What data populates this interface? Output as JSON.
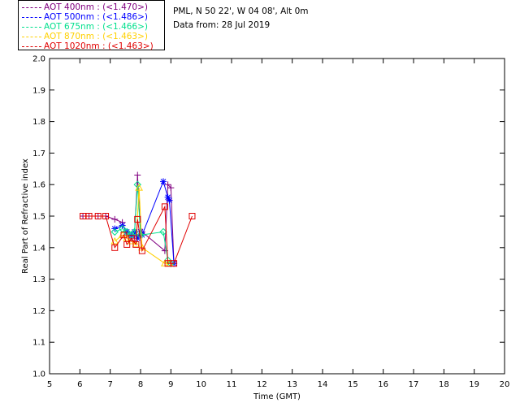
{
  "header": {
    "site": "PML, N 50 22', W 04 08', Alt 0m",
    "date_line": "Data from: 28 Jul 2019"
  },
  "legend": [
    {
      "label": "AOT  400nm : (<1.470>)",
      "color": "#800080"
    },
    {
      "label": "AOT  500nm : (<1.486>)",
      "color": "#0000ff"
    },
    {
      "label": "AOT  675nm : (<1.466>)",
      "color": "#00e08c"
    },
    {
      "label": "AOT  870nm : (<1.463>)",
      "color": "#ffd000"
    },
    {
      "label": "AOT 1020nm : (<1.463>)",
      "color": "#e00000"
    }
  ],
  "chart_data": {
    "type": "scatter",
    "xlabel": "Time (GMT)",
    "ylabel": "Real Part of Refractive index",
    "xlim": [
      5,
      20
    ],
    "ylim": [
      1.0,
      2.0
    ],
    "x_ticks": [
      "5",
      "6",
      "7",
      "8",
      "9",
      "10",
      "11",
      "12",
      "13",
      "14",
      "15",
      "16",
      "17",
      "18",
      "19",
      "20"
    ],
    "y_ticks": [
      "1.0",
      "1.1",
      "1.2",
      "1.3",
      "1.4",
      "1.5",
      "1.6",
      "1.7",
      "1.8",
      "1.9",
      "2.0"
    ],
    "series": [
      {
        "name": "AOT  400nm",
        "color": "#800080",
        "marker": "plus",
        "points": [
          [
            6.1,
            1.5
          ],
          [
            6.3,
            1.5
          ],
          [
            6.6,
            1.5
          ],
          [
            6.85,
            1.5
          ],
          [
            7.15,
            1.49
          ],
          [
            7.4,
            1.48
          ],
          [
            7.55,
            1.44
          ],
          [
            7.7,
            1.43
          ],
          [
            7.8,
            1.44
          ],
          [
            7.9,
            1.63
          ],
          [
            8.0,
            1.44
          ],
          [
            8.05,
            1.45
          ],
          [
            8.8,
            1.39
          ],
          [
            8.9,
            1.6
          ],
          [
            9.0,
            1.59
          ],
          [
            9.1,
            1.35
          ]
        ]
      },
      {
        "name": "AOT  500nm",
        "color": "#0000ff",
        "marker": "asterisk",
        "points": [
          [
            7.15,
            1.46
          ],
          [
            7.4,
            1.47
          ],
          [
            7.55,
            1.45
          ],
          [
            7.7,
            1.44
          ],
          [
            7.8,
            1.45
          ],
          [
            7.9,
            1.43
          ],
          [
            8.0,
            1.45
          ],
          [
            8.05,
            1.44
          ],
          [
            8.75,
            1.61
          ],
          [
            8.9,
            1.56
          ],
          [
            8.95,
            1.55
          ],
          [
            9.1,
            1.35
          ]
        ]
      },
      {
        "name": "AOT  675nm",
        "color": "#00e08c",
        "marker": "diamond",
        "points": [
          [
            7.15,
            1.45
          ],
          [
            7.4,
            1.46
          ],
          [
            7.55,
            1.45
          ],
          [
            7.7,
            1.44
          ],
          [
            7.8,
            1.45
          ],
          [
            7.9,
            1.6
          ],
          [
            8.0,
            1.44
          ],
          [
            8.75,
            1.45
          ],
          [
            8.9,
            1.36
          ],
          [
            9.0,
            1.35
          ]
        ]
      },
      {
        "name": "AOT  870nm",
        "color": "#ffd000",
        "marker": "triangle",
        "points": [
          [
            7.15,
            1.42
          ],
          [
            7.4,
            1.44
          ],
          [
            7.55,
            1.43
          ],
          [
            7.7,
            1.42
          ],
          [
            7.85,
            1.41
          ],
          [
            7.95,
            1.59
          ],
          [
            8.05,
            1.4
          ],
          [
            8.8,
            1.35
          ],
          [
            8.95,
            1.35
          ]
        ]
      },
      {
        "name": "AOT 1020nm",
        "color": "#e00000",
        "marker": "square",
        "points": [
          [
            6.1,
            1.5
          ],
          [
            6.3,
            1.5
          ],
          [
            6.6,
            1.5
          ],
          [
            6.85,
            1.5
          ],
          [
            7.15,
            1.4
          ],
          [
            7.45,
            1.44
          ],
          [
            7.55,
            1.41
          ],
          [
            7.7,
            1.43
          ],
          [
            7.85,
            1.41
          ],
          [
            7.9,
            1.49
          ],
          [
            8.05,
            1.39
          ],
          [
            8.8,
            1.53
          ],
          [
            8.9,
            1.35
          ],
          [
            9.1,
            1.35
          ],
          [
            9.7,
            1.5
          ]
        ]
      }
    ]
  }
}
